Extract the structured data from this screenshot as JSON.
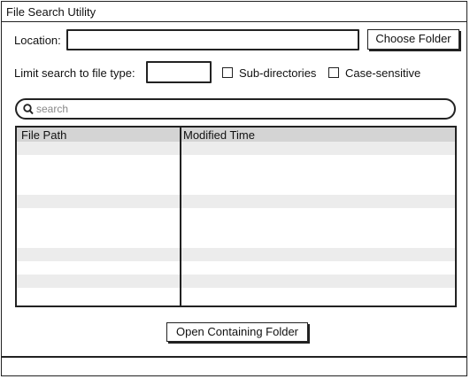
{
  "window": {
    "title": "File Search Utility"
  },
  "location": {
    "label": "Location:",
    "value": "",
    "choose_button": "Choose Folder"
  },
  "filters": {
    "file_type_label": "Limit search to file type:",
    "file_type_value": "",
    "subdirs_label": "Sub-directories",
    "subdirs_checked": false,
    "case_label": "Case-sensitive",
    "case_checked": false
  },
  "search": {
    "placeholder": "search",
    "value": ""
  },
  "results": {
    "columns": [
      "File Path",
      "Modified Time"
    ],
    "rows": []
  },
  "actions": {
    "open_folder": "Open Containing Folder"
  },
  "colors": {
    "header_bg": "#d4d4d4",
    "row_alt": "#ececec",
    "border": "#222222"
  }
}
